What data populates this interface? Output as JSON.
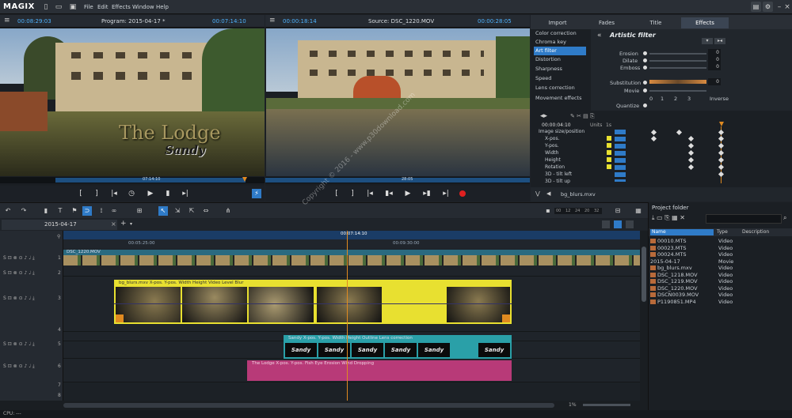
{
  "app": {
    "logo": "MAGIX"
  },
  "menu": [
    "File",
    "Edit",
    "Effects",
    "Window",
    "Help"
  ],
  "program_monitor": {
    "timecode_left": "00:08:29:03",
    "title": "Program: 2015-04-17 *",
    "timecode_right": "00:07:14:10",
    "scrub_time": "07:14:10",
    "overlay_title": "The Lodge",
    "overlay_subtitle": "Sandy"
  },
  "source_monitor": {
    "timecode_left": "00:00:18:14",
    "title": "Source: DSC_1220.MOV",
    "timecode_right": "00:00:28:05",
    "scrub_time": "28:05"
  },
  "right_tabs": [
    "Import",
    "Fades",
    "Title",
    "Effects"
  ],
  "effects_list": [
    "Color correction",
    "Chroma key",
    "Art filter",
    "Distortion",
    "Sharpness",
    "Speed",
    "Lens correction",
    "Movement effects"
  ],
  "effects_selected": "Art filter",
  "filter_panel": {
    "title": "Artistic filter",
    "params": [
      {
        "label": "Erosion",
        "value": "0"
      },
      {
        "label": "Dilate",
        "value": "0"
      },
      {
        "label": "Emboss",
        "value": "0"
      },
      {
        "label": "Substitution",
        "value": "0"
      },
      {
        "label": "Movie",
        "value": ""
      },
      {
        "label": "Quantize",
        "value": ""
      }
    ],
    "quantize_scale": [
      "0",
      "1",
      "2",
      "3",
      "Inverse"
    ]
  },
  "keyframes": {
    "time": "00:00:04:10",
    "units": [
      "Units",
      "1s"
    ],
    "rows": [
      "Image size/position",
      "X-pos.",
      "Y-pos.",
      "Width",
      "Height",
      "Rotation",
      "3D - tilt left",
      "3D - tilt up"
    ],
    "clip": "bg_blurs.mxv"
  },
  "timeline": {
    "tab": "2015-04-17",
    "ruler": [
      "00:07:14:10",
      "00:05:25:00",
      "00:09:30:00"
    ],
    "video_clip": "DSC_1220.MOV",
    "track3_clip": "bg_blurs.mxv  X-pos.  Y-pos.  Width  Height  Video Level  Blur",
    "track5_clip": "Sandy  X-pos.  Y-pos.  Width  Height  Outline  Lens correction",
    "track6_clip": "The Lodge  X-pos.  Y-pos.  Fish Eye  Erosion  Wind  Dropping",
    "sandy_label": "Sandy",
    "track_numbers": [
      "1",
      "2",
      "3",
      "4",
      "5",
      "6",
      "7",
      "8"
    ],
    "zoom": "1%",
    "meter": [
      "00",
      "12",
      "24",
      "20",
      "32"
    ]
  },
  "project_folder": {
    "title": "Project folder",
    "columns": [
      "Name",
      "Type",
      "Description"
    ],
    "items": [
      {
        "name": "00010.MTS",
        "type": "Video",
        "icon": true
      },
      {
        "name": "00023.MTS",
        "type": "Video",
        "icon": true
      },
      {
        "name": "00024.MTS",
        "type": "Video",
        "icon": true
      },
      {
        "name": "2015-04-17",
        "type": "Movie",
        "icon": false
      },
      {
        "name": "bg_blurs.mxv",
        "type": "Video",
        "icon": true
      },
      {
        "name": "DSC_1218.MOV",
        "type": "Video",
        "icon": true
      },
      {
        "name": "DSC_1219.MOV",
        "type": "Video",
        "icon": true
      },
      {
        "name": "DSC_1220.MOV",
        "type": "Video",
        "icon": true
      },
      {
        "name": "DSCN0039.MOV",
        "type": "Video",
        "icon": true
      },
      {
        "name": "P1190851.MP4",
        "type": "Video",
        "icon": true
      }
    ]
  },
  "status": {
    "cpu": "CPU: ---"
  },
  "watermark": "Copyright © 2016 - www.p30download.com",
  "colors": {
    "accent": "#2f7bc8",
    "timecode": "#4fb3ff",
    "playhead": "#e08a20",
    "yellow_clip": "#e8e030",
    "teal_clip": "#2aa0a8",
    "pink_clip": "#b83a78"
  }
}
